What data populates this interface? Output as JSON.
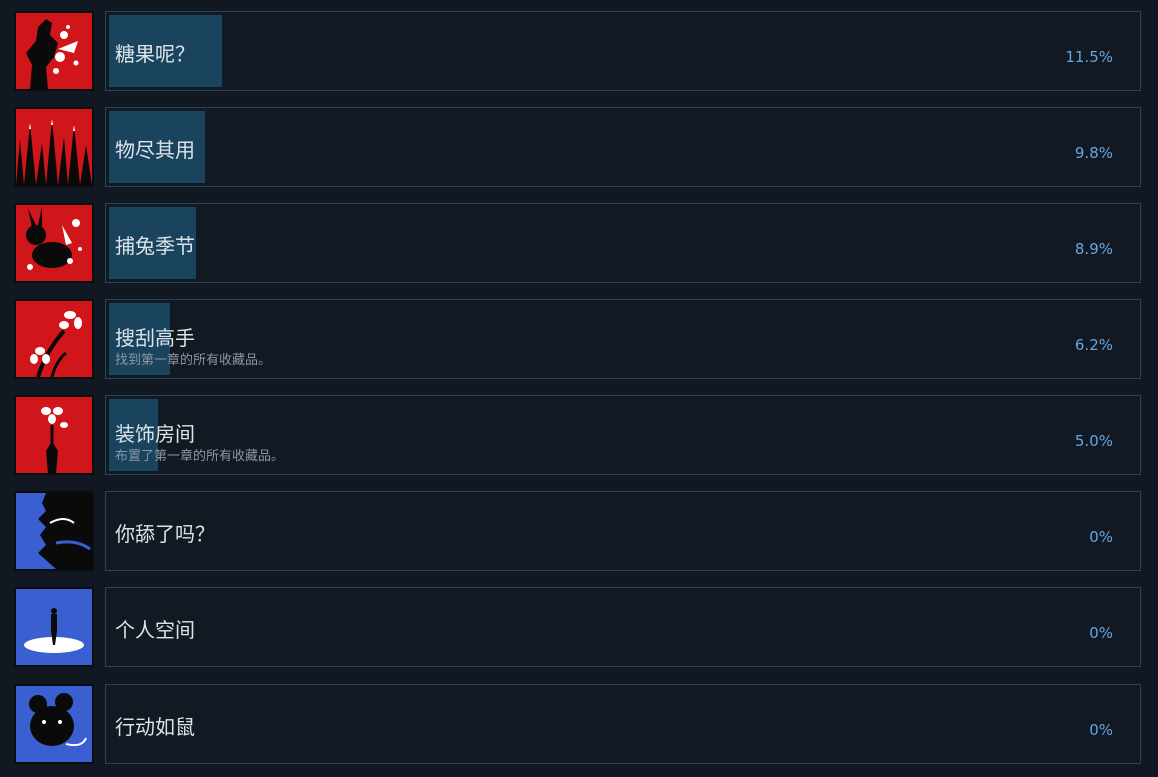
{
  "achievements": [
    {
      "title": "糖果呢？",
      "description": "",
      "percent_label": "11.5%",
      "percent": 11.5,
      "icon": "candy-fist-icon",
      "theme": "red"
    },
    {
      "title": "物尽其用",
      "description": "",
      "percent_label": "9.8%",
      "percent": 9.8,
      "icon": "spikes-icon",
      "theme": "red"
    },
    {
      "title": "捕兔季节",
      "description": "",
      "percent_label": "8.9%",
      "percent": 8.9,
      "icon": "rabbit-icon",
      "theme": "red"
    },
    {
      "title": "搜刮高手",
      "description": "找到第一章的所有收藏品。",
      "percent_label": "6.2%",
      "percent": 6.2,
      "icon": "flower-icon",
      "theme": "red"
    },
    {
      "title": "装饰房间",
      "description": "布置了第一章的所有收藏品。",
      "percent_label": "5.0%",
      "percent": 5.0,
      "icon": "vase-flower-icon",
      "theme": "red"
    },
    {
      "title": "你舔了吗？",
      "description": "",
      "percent_label": "0%",
      "percent": 0,
      "icon": "tongue-face-icon",
      "theme": "blue"
    },
    {
      "title": "个人空间",
      "description": "",
      "percent_label": "0%",
      "percent": 0,
      "icon": "standing-figure-icon",
      "theme": "blue"
    },
    {
      "title": "行动如鼠",
      "description": "",
      "percent_label": "0%",
      "percent": 0,
      "icon": "mouse-icon",
      "theme": "blue"
    }
  ],
  "colors": {
    "background": "#111821",
    "card_border": "#24455a",
    "progress_fill": "#1a445e",
    "title_text": "#dde3ea",
    "description_text": "#8b97a3",
    "percent_text": "#62a6e6",
    "icon_red": "#d0161a",
    "icon_blue": "#3a5fd0"
  }
}
